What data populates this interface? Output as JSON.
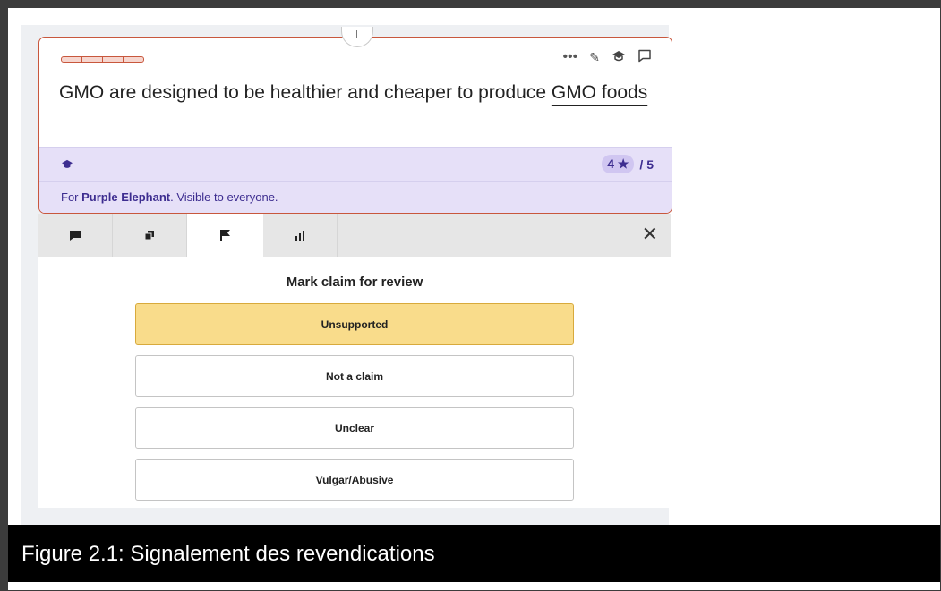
{
  "claim": {
    "text": "GMO are designed to be healthier and cheaper to produce ",
    "tag": "GMO foods",
    "tools": {
      "more": "•••",
      "edit": "✎",
      "cap": "🎓",
      "comment": "☐"
    }
  },
  "band": {
    "rating_value": "4 ★",
    "rating_total": "/ 5"
  },
  "visibility": {
    "prefix": "For ",
    "group": "Purple Elephant",
    "suffix": ". Visible to everyone."
  },
  "tabs": [
    {
      "icon": "comment-icon"
    },
    {
      "icon": "copy-icon"
    },
    {
      "icon": "flag-icon",
      "active": true
    },
    {
      "icon": "bar-chart-icon"
    }
  ],
  "close": "✕",
  "review": {
    "title": "Mark claim for review",
    "options": [
      "Unsupported",
      "Not a claim",
      "Unclear",
      "Vulgar/Abusive"
    ],
    "selected": "Unsupported"
  },
  "caption": "Figure 2.1: Signalement des revendications",
  "colors": {
    "accent_border": "#c8573d",
    "band": "#e6e0f8",
    "selected_option": "#f9dc8b"
  }
}
